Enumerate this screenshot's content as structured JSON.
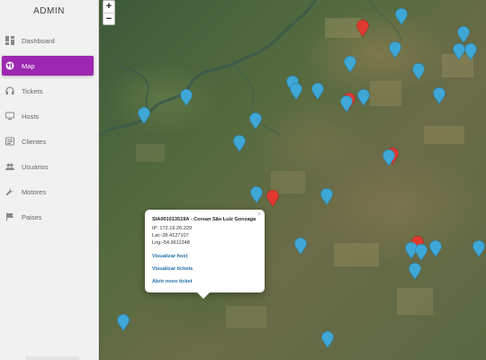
{
  "sidebar": {
    "title": "ADMIN",
    "items": [
      {
        "label": "Dashboard",
        "icon": "dashboard-icon",
        "active": false
      },
      {
        "label": "Map",
        "icon": "globe-icon",
        "active": true
      },
      {
        "label": "Tickets",
        "icon": "headset-icon",
        "active": false
      },
      {
        "label": "Hosts",
        "icon": "monitor-icon",
        "active": false
      },
      {
        "label": "Clientes",
        "icon": "list-icon",
        "active": false
      },
      {
        "label": "Usuários",
        "icon": "users-icon",
        "active": false
      },
      {
        "label": "Motores",
        "icon": "wrench-icon",
        "active": false
      },
      {
        "label": "Paises",
        "icon": "flag-icon",
        "active": false
      }
    ],
    "accent_color": "#9c27b0"
  },
  "map": {
    "zoom_in_label": "+",
    "zoom_out_label": "−",
    "marker_colors": {
      "blue": "#3fa7d6",
      "red": "#e03a2f"
    }
  },
  "popup": {
    "title": "SIA001013519A - Corsan São Luiz Gonzaga",
    "ip": "IP: 172.16.26.229",
    "lat": "Lat:-28.4127107",
    "lng": "Lng:-54.9611348",
    "link_host": "Visualizar host",
    "link_tickets": "Visualizar tickets",
    "link_new_ticket": "Abrir novo ticket",
    "close_label": "×"
  }
}
